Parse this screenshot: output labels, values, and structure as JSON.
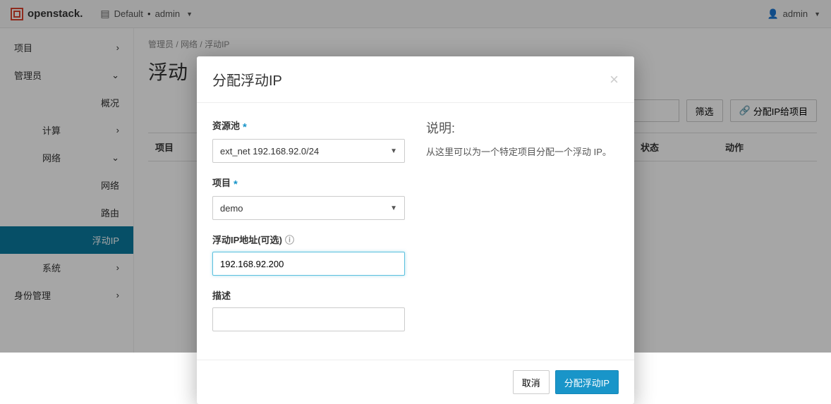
{
  "navbar": {
    "brand": "openstack.",
    "domain_label": "Default",
    "project_label": "admin",
    "user_label": "admin"
  },
  "sidebar": {
    "project": "项目",
    "admin": "管理员",
    "overview": "概况",
    "compute": "计算",
    "network": "网络",
    "network_sub": "网络",
    "router": "路由",
    "floating_ip": "浮动IP",
    "system": "系统",
    "identity": "身份管理"
  },
  "breadcrumb": {
    "p1": "管理员",
    "p2": "网络",
    "p3": "浮动IP"
  },
  "page": {
    "title": "浮动",
    "filter_btn": "筛选",
    "allocate_btn": "分配IP给项目",
    "col_project": "项目",
    "col_status": "状态",
    "col_action": "动作"
  },
  "modal": {
    "title": "分配浮动IP",
    "pool_label": "资源池",
    "pool_value": "ext_net 192.168.92.0/24",
    "project_label": "项目",
    "project_value": "demo",
    "ipaddr_label": "浮动IP地址(可选)",
    "ipaddr_value": "192.168.92.200",
    "desc_label": "描述",
    "desc_title": "说明:",
    "desc_text": "从这里可以为一个特定项目分配一个浮动 IP。",
    "cancel": "取消",
    "submit": "分配浮动IP"
  }
}
